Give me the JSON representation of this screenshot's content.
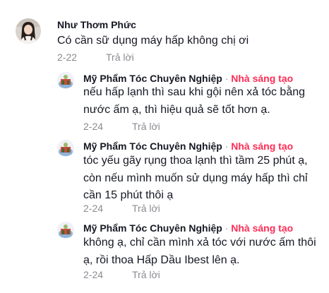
{
  "comment": {
    "username": "Như Thơm Phức",
    "text": "Có cần sữ dụng máy hấp không chị ơi",
    "date": "2-22",
    "reply_label": "Trả lời"
  },
  "replies": [
    {
      "username": "Mỹ Phẩm Tóc Chuyên Nghiệp",
      "separator": "·",
      "badge": "Nhà sáng tạo",
      "lines": [
        "nếu hấp lạnh thì sau khi gội nên xả tóc bằng",
        "nước ấm ạ, thì hiệu quả sẽ tốt hơn ạ."
      ],
      "date": "2-24",
      "reply_label": "Trả lời"
    },
    {
      "username": "Mỹ Phẩm Tóc Chuyên Nghiệp",
      "separator": "·",
      "badge": "Nhà sáng tạo",
      "lines": [
        "tóc yếu gãy rụng thoa lạnh thì tầm 25 phút ạ,",
        "còn nếu mình muốn sử dụng máy hấp thì chỉ",
        "cần 15 phút thôi ạ"
      ],
      "date": "2-24",
      "reply_label": "Trả lời"
    },
    {
      "username": "Mỹ Phẩm Tóc Chuyên Nghiệp",
      "separator": "·",
      "badge": "Nhà sáng tạo",
      "lines": [
        "không ạ, chỉ cần mình xả tóc với nước ấm thôi",
        "ạ, rồi thoa Hấp Dầu Ibest lên ạ."
      ],
      "date": "2-24",
      "reply_label": "Trả lời"
    }
  ]
}
